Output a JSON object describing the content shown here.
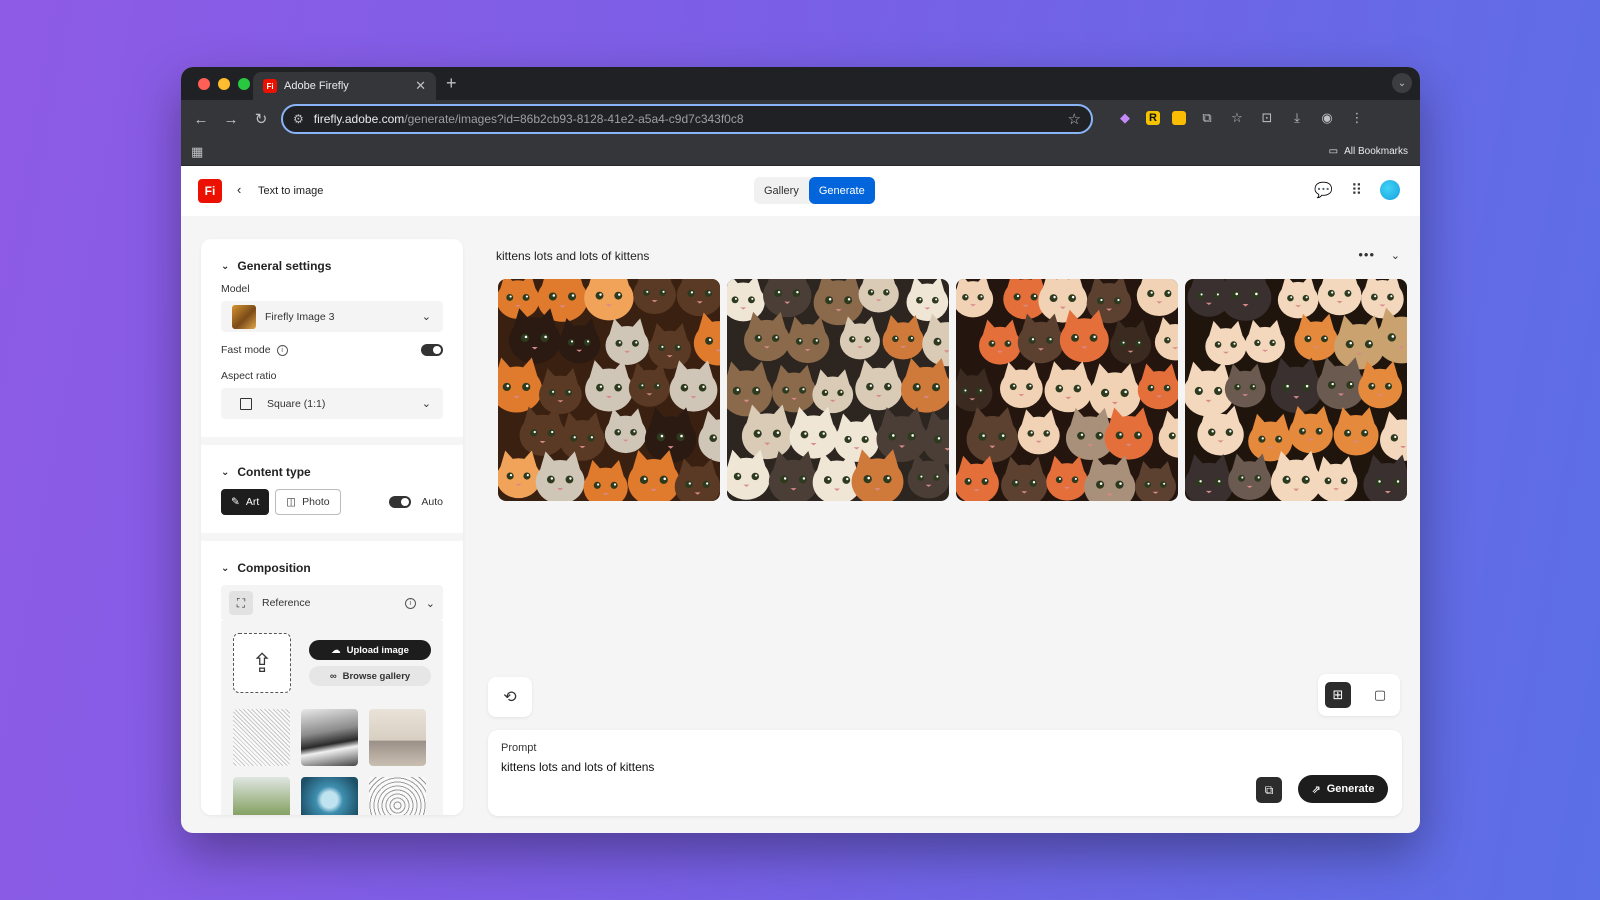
{
  "browser": {
    "tab_title": "Adobe Firefly",
    "tab_favicon_text": "Fi",
    "url_host": "firefly.adobe.com",
    "url_path": "/generate/images?id=86b2cb93-8128-41e2-a5a4-c9d7c343f0c8",
    "bookmarks_label": "All Bookmarks",
    "traffic_colors": [
      "#ff5f57",
      "#febc2e",
      "#28c840"
    ]
  },
  "header": {
    "logo_text": "Fi",
    "page_title": "Text to image",
    "tab_gallery": "Gallery",
    "tab_generate": "Generate",
    "accent_color": "#0265dc",
    "brand_color": "#eb1000"
  },
  "sidebar": {
    "general": {
      "title": "General settings",
      "model_label": "Model",
      "model_value": "Firefly Image 3",
      "fast_mode_label": "Fast mode",
      "fast_mode_on": true,
      "aspect_label": "Aspect ratio",
      "aspect_value": "Square (1:1)"
    },
    "content": {
      "title": "Content type",
      "art_label": "Art",
      "photo_label": "Photo",
      "auto_label": "Auto",
      "auto_on": true
    },
    "composition": {
      "title": "Composition",
      "reference_label": "Reference",
      "upload_label": "Upload image",
      "browse_label": "Browse gallery"
    }
  },
  "main": {
    "prompt_title": "kittens lots and lots of kittens",
    "prompt_label": "Prompt",
    "prompt_value": "kittens lots and lots of kittens",
    "generate_label": "Generate",
    "images_count": 4
  }
}
